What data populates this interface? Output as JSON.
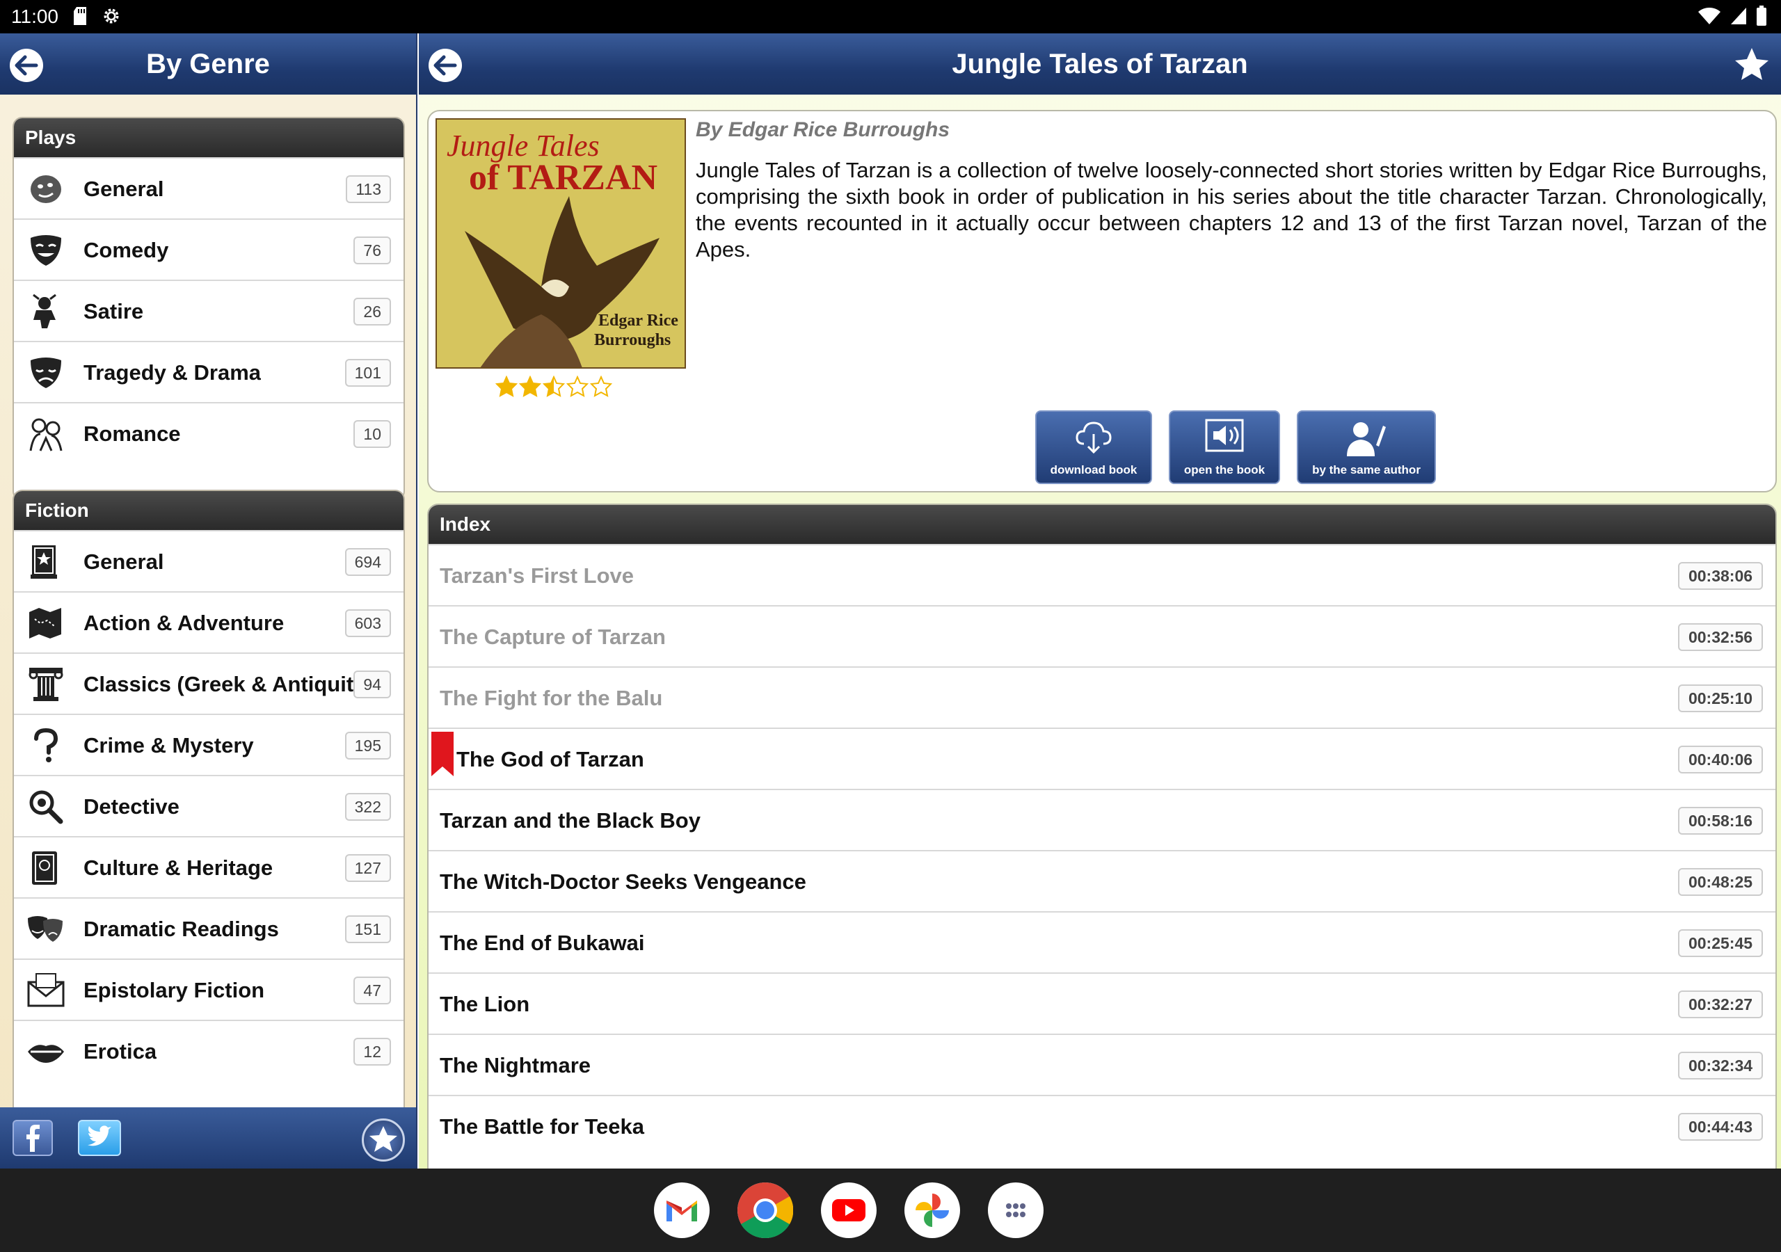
{
  "status": {
    "time": "11:00"
  },
  "left": {
    "title": "By Genre",
    "sections": [
      {
        "title": "Plays",
        "items": [
          {
            "label": "General",
            "count": "113",
            "icon": "theater-mask-icon"
          },
          {
            "label": "Comedy",
            "count": "76",
            "icon": "comedy-mask-icon"
          },
          {
            "label": "Satire",
            "count": "26",
            "icon": "jester-icon"
          },
          {
            "label": "Tragedy & Drama",
            "count": "101",
            "icon": "tragedy-mask-icon"
          },
          {
            "label": "Romance",
            "count": "10",
            "icon": "romance-icon"
          }
        ]
      },
      {
        "title": "Fiction",
        "items": [
          {
            "label": "General",
            "count": "694",
            "icon": "book-icon"
          },
          {
            "label": "Action & Adventure",
            "count": "603",
            "icon": "map-icon"
          },
          {
            "label": "Classics (Greek & Antiquity",
            "count": "94",
            "icon": "column-icon"
          },
          {
            "label": "Crime & Mystery",
            "count": "195",
            "icon": "question-icon"
          },
          {
            "label": "Detective",
            "count": "322",
            "icon": "magnifier-icon"
          },
          {
            "label": "Culture & Heritage",
            "count": "127",
            "icon": "heritage-book-icon"
          },
          {
            "label": "Dramatic Readings",
            "count": "151",
            "icon": "drama-masks-icon"
          },
          {
            "label": "Epistolary Fiction",
            "count": "47",
            "icon": "envelope-icon"
          },
          {
            "label": "Erotica",
            "count": "12",
            "icon": "lips-icon"
          }
        ]
      }
    ]
  },
  "book": {
    "title": "Jungle Tales of Tarzan",
    "author": "By Edgar Rice Burroughs",
    "cover_title_line1": "Jungle Tales",
    "cover_title_line2": "of TARZAN",
    "cover_author_line1": "Edgar Rice",
    "cover_author_line2": "Burroughs",
    "rating": 2.5,
    "rating_max": 5,
    "description": "Jungle Tales of Tarzan is a collection of twelve loosely-connected short stories written by Edgar Rice Burroughs, comprising the sixth book in order of publication in his series about the title character Tarzan. Chronologically, the events recounted in it actually occur between chapters 12 and 13 of the first Tarzan novel, Tarzan of the Apes.",
    "buttons": {
      "download": "download book",
      "open": "open the book",
      "same_author": "by the same author"
    }
  },
  "index": {
    "title": "Index",
    "chapters": [
      {
        "title": "Tarzan's First Love",
        "time": "00:38:06",
        "played": true,
        "bookmarked": false
      },
      {
        "title": "The Capture of Tarzan",
        "time": "00:32:56",
        "played": true,
        "bookmarked": false
      },
      {
        "title": "The Fight for the Balu",
        "time": "00:25:10",
        "played": true,
        "bookmarked": false
      },
      {
        "title": "The God of Tarzan",
        "time": "00:40:06",
        "played": false,
        "bookmarked": true
      },
      {
        "title": "Tarzan and the Black Boy",
        "time": "00:58:16",
        "played": false,
        "bookmarked": false
      },
      {
        "title": "The Witch-Doctor Seeks Vengeance",
        "time": "00:48:25",
        "played": false,
        "bookmarked": false
      },
      {
        "title": "The End of Bukawai",
        "time": "00:25:45",
        "played": false,
        "bookmarked": false
      },
      {
        "title": "The Lion",
        "time": "00:32:27",
        "played": false,
        "bookmarked": false
      },
      {
        "title": "The Nightmare",
        "time": "00:32:34",
        "played": false,
        "bookmarked": false
      },
      {
        "title": "The Battle for Teeka",
        "time": "00:44:43",
        "played": false,
        "bookmarked": false
      }
    ]
  },
  "colors": {
    "header_blue": "#1f3a70",
    "bookmark_red": "#e0161d",
    "star_gold": "#f2b600"
  }
}
